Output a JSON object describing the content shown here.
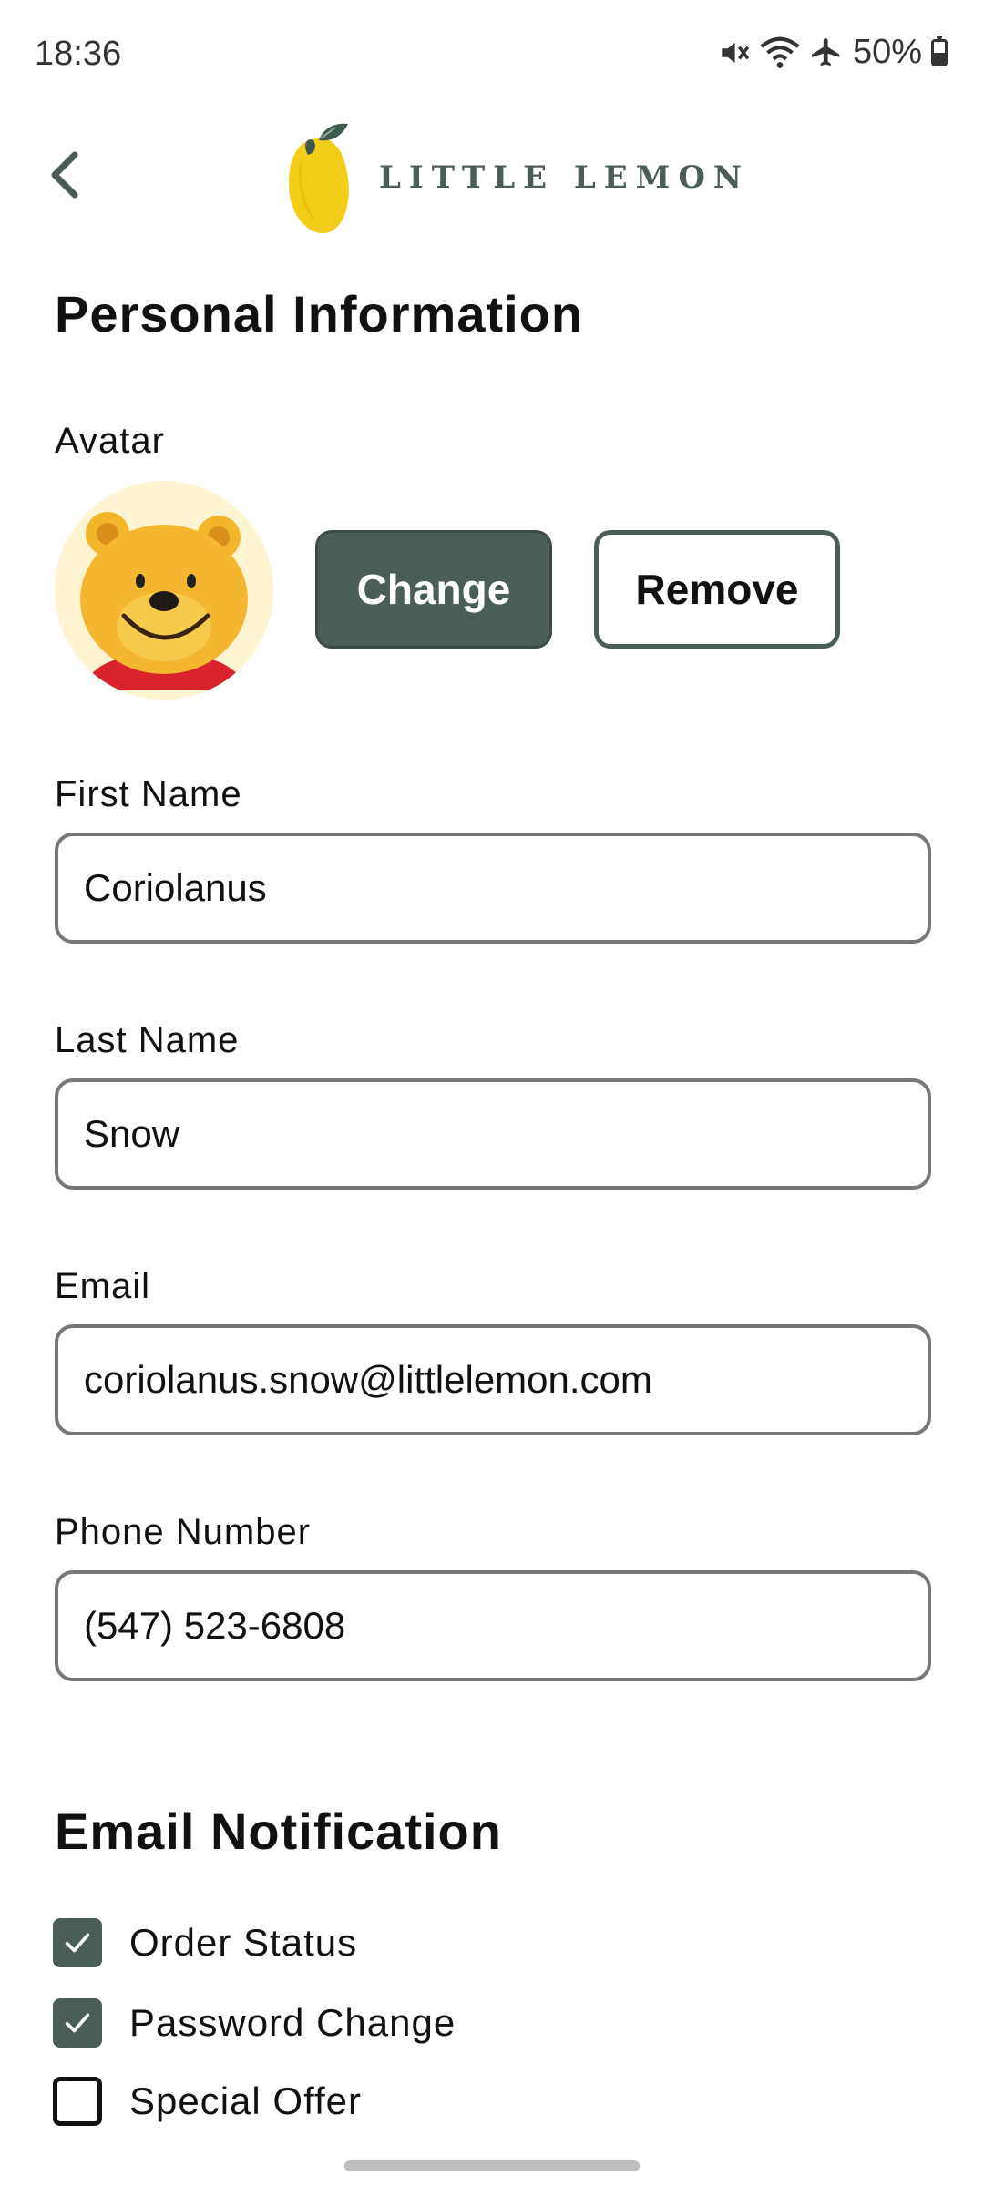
{
  "status_bar": {
    "time": "18:36",
    "battery": "50%",
    "battery_level": 0.5,
    "icons": [
      "mute-icon",
      "wifi-icon",
      "airplane-icon",
      "battery-icon"
    ]
  },
  "header": {
    "logo_text": "LITTLE LEMON",
    "back_icon": "chevron-left-icon"
  },
  "personal": {
    "title": "Personal Information",
    "avatar_label": "Avatar",
    "change_label": "Change",
    "remove_label": "Remove",
    "first_name_label": "First Name",
    "first_name_value": "Coriolanus",
    "last_name_label": "Last Name",
    "last_name_value": "Snow",
    "email_label": "Email",
    "email_value": "coriolanus.snow@littlelemon.com",
    "phone_label": "Phone Number",
    "phone_value": "(547) 523-6808"
  },
  "notifications": {
    "title": "Email Notification",
    "items": [
      {
        "label": "Order Status",
        "checked": true
      },
      {
        "label": "Password Change",
        "checked": true
      },
      {
        "label": "Special Offer",
        "checked": false
      }
    ]
  },
  "colors": {
    "accent": "#4a5e55",
    "lemon": "#f4cd1a",
    "border": "#777777"
  }
}
